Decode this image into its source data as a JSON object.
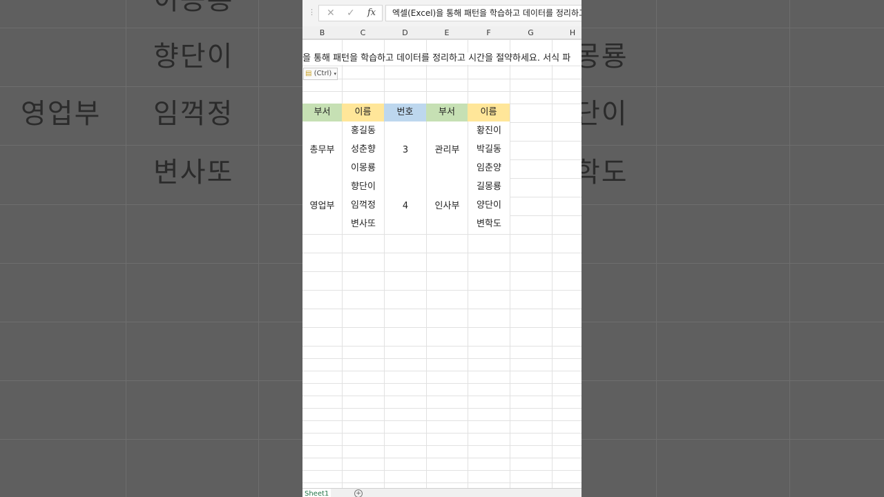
{
  "background": {
    "rows": [
      {
        "left_text": "",
        "right_text": "향단이"
      },
      {
        "left_text": "영업부",
        "right_text": "임꺽정"
      },
      {
        "left_text": "",
        "right_text": "변사또"
      }
    ],
    "right_fragments": [
      "몽룡",
      "단이",
      "학도"
    ],
    "top_fragment": "이몽룡"
  },
  "formula_bar": {
    "cancel_icon": "✕",
    "enter_icon": "✓",
    "fx_icon": "fx",
    "value": "엑셀(Excel)을 통해 패턴을 학습하고 데이터를 정리하고"
  },
  "column_headers": [
    "B",
    "C",
    "D",
    "E",
    "F",
    "G",
    "H"
  ],
  "overflow_text": "을 통해 패턴을 학습하고 데이터를 정리하고 시간을 절약하세요. 서식 파",
  "paste_options": "(Ctrl)",
  "table": {
    "headers": [
      "부서",
      "이름",
      "번호",
      "부서",
      "이름"
    ],
    "header_colors": [
      "#c6e0b4",
      "#ffe699",
      "#bdd7ee",
      "#c6e0b4",
      "#ffe699"
    ],
    "groups": [
      {
        "dept": "총무부",
        "names": [
          "홍길동",
          "성춘향",
          "이몽룡"
        ],
        "number": "3",
        "dept2": "관리부",
        "names2": [
          "황진이",
          "박길동",
          "임춘양"
        ]
      },
      {
        "dept": "영업부",
        "names": [
          "향단이",
          "임꺽정",
          "변사또"
        ],
        "number": "4",
        "dept2": "인사부",
        "names2": [
          "길몽룡",
          "양단이",
          "변학도"
        ]
      }
    ]
  },
  "sheet_tabs": {
    "active": "Sheet1",
    "add_icon": "+"
  }
}
